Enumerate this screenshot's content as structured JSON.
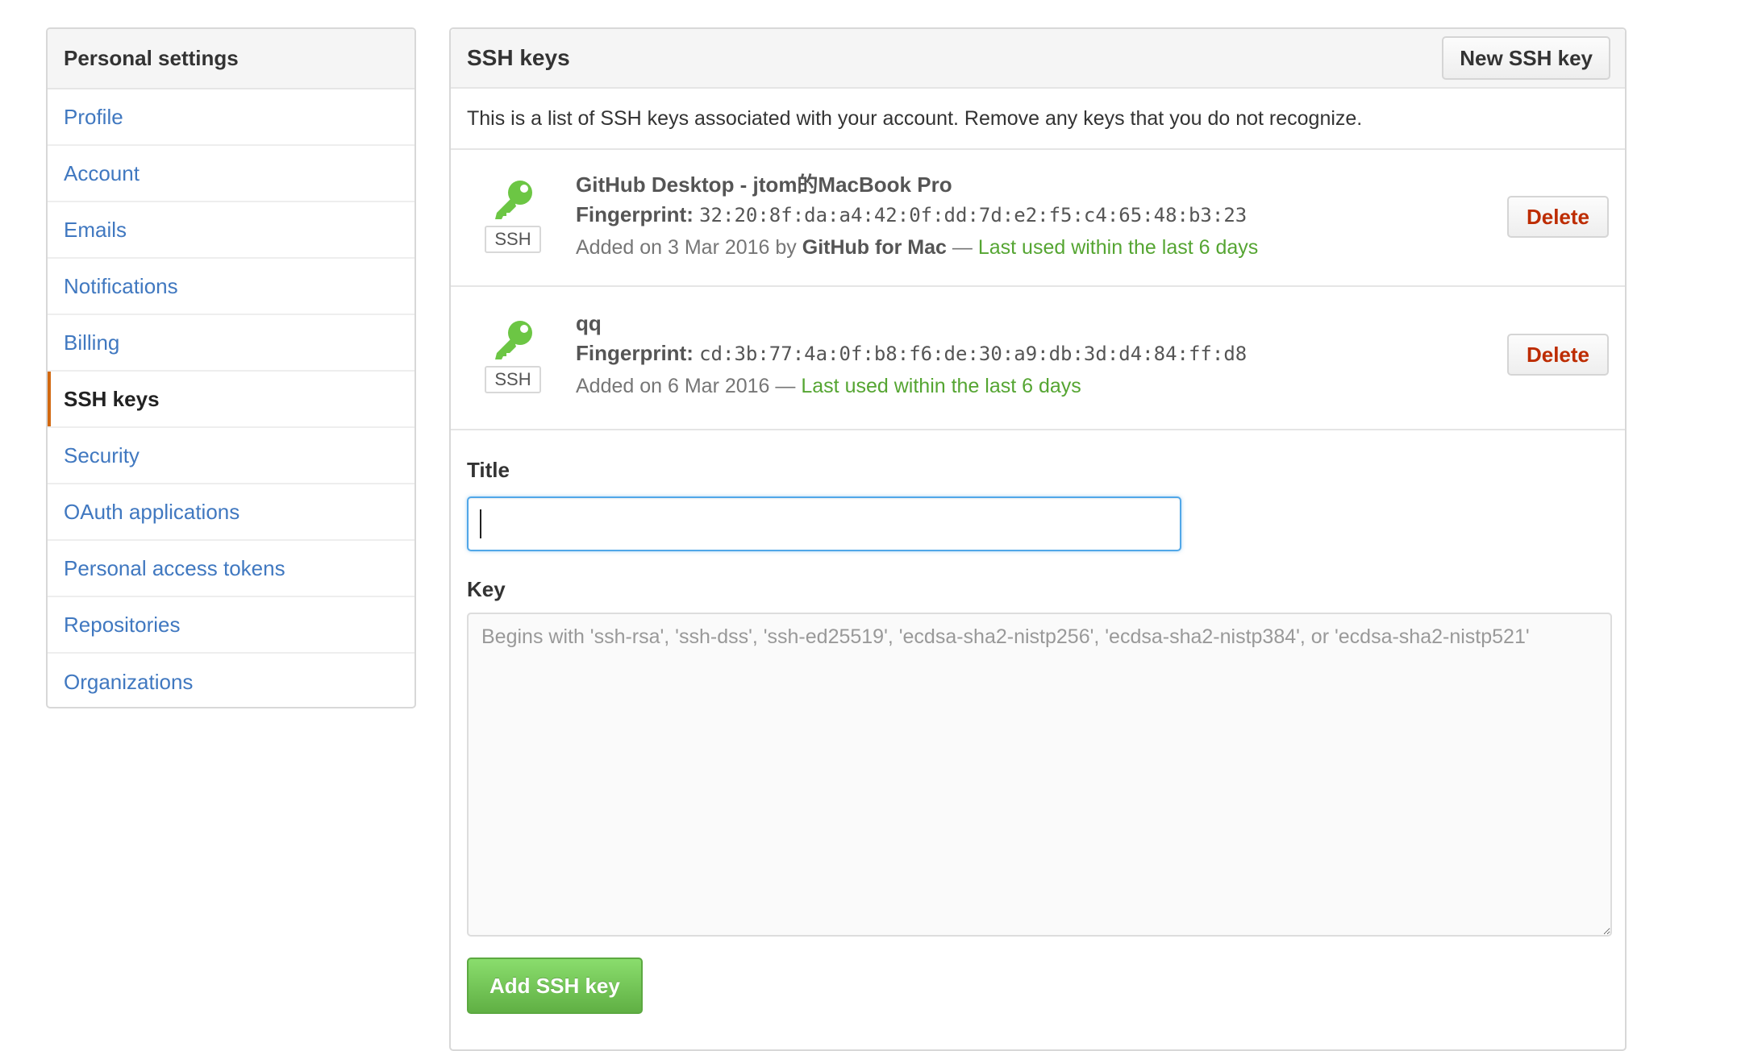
{
  "sidebar": {
    "title": "Personal settings",
    "items": [
      {
        "label": "Profile"
      },
      {
        "label": "Account"
      },
      {
        "label": "Emails"
      },
      {
        "label": "Notifications"
      },
      {
        "label": "Billing"
      },
      {
        "label": "SSH keys",
        "selected": true
      },
      {
        "label": "Security"
      },
      {
        "label": "OAuth applications"
      },
      {
        "label": "Personal access tokens"
      },
      {
        "label": "Repositories"
      },
      {
        "label": "Organizations"
      }
    ]
  },
  "main": {
    "title": "SSH keys",
    "new_button_label": "New SSH key",
    "intro": "This is a list of SSH keys associated with your account. Remove any keys that you do not recognize.",
    "keys": [
      {
        "title": "GitHub Desktop - jtom的MacBook Pro",
        "badge": "SSH",
        "fingerprint_label": "Fingerprint:",
        "fingerprint": "32:20:8f:da:a4:42:0f:dd:7d:e2:f5:c4:65:48:b3:23",
        "added_prefix": "Added on 3 Mar 2016 by",
        "added_by": "GitHub for Mac",
        "separator": "—",
        "last_used": "Last used within the last 6 days",
        "delete_label": "Delete"
      },
      {
        "title": "qq",
        "badge": "SSH",
        "fingerprint_label": "Fingerprint:",
        "fingerprint": "cd:3b:77:4a:0f:b8:f6:de:30:a9:db:3d:d4:84:ff:d8",
        "added_prefix": "Added on 6 Mar 2016",
        "added_by": "",
        "separator": "—",
        "last_used": "Last used within the last 6 days",
        "delete_label": "Delete"
      }
    ],
    "form": {
      "title_label": "Title",
      "title_value": "",
      "key_label": "Key",
      "key_placeholder": "Begins with 'ssh-rsa', 'ssh-dss', 'ssh-ed25519', 'ecdsa-sha2-nistp256', 'ecdsa-sha2-nistp384', or 'ecdsa-sha2-nistp521'",
      "submit_label": "Add SSH key"
    }
  },
  "colors": {
    "link": "#4078c0",
    "selected_marker": "#d26911",
    "key_icon": "#6cc644",
    "recent": "#55a532",
    "danger": "#bd2c00",
    "focus": "#51a7e8"
  },
  "icons": {
    "key": "key-icon"
  }
}
